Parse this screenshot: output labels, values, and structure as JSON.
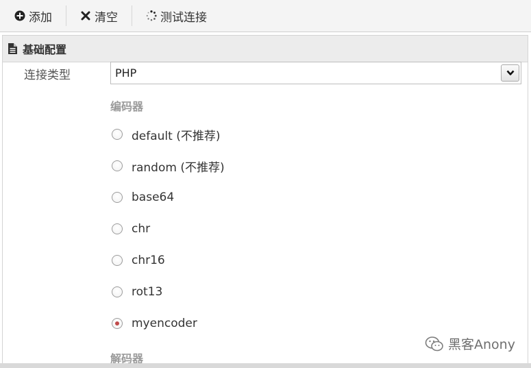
{
  "toolbar": {
    "add_label": "添加",
    "clear_label": "清空",
    "test_label": "测试连接"
  },
  "section": {
    "title": "基础配置"
  },
  "form": {
    "connection_type_label": "连接类型",
    "connection_type_value": "PHP",
    "encoder_title": "编码器",
    "encoders": [
      {
        "label": "default (不推荐)",
        "checked": false
      },
      {
        "label": "random (不推荐)",
        "checked": false
      },
      {
        "label": "base64",
        "checked": false
      },
      {
        "label": "chr",
        "checked": false
      },
      {
        "label": "chr16",
        "checked": false
      },
      {
        "label": "rot13",
        "checked": false
      },
      {
        "label": "myencoder",
        "checked": true
      }
    ],
    "decoder_title": "解码器"
  },
  "watermark": {
    "text": "黑客Anony"
  },
  "icons": {
    "add": "plus-circle-icon",
    "clear": "x-icon",
    "test": "spinner-icon",
    "section": "document-icon",
    "select_arrow": "chevron-down-icon"
  }
}
